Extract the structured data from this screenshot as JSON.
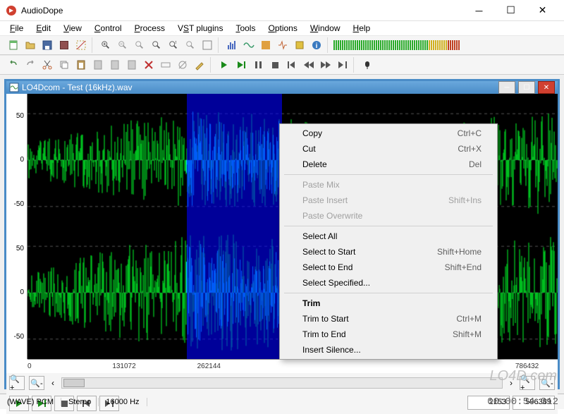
{
  "app": {
    "title": "AudioDope"
  },
  "menubar": [
    "File",
    "Edit",
    "View",
    "Control",
    "Process",
    "VST plugins",
    "Tools",
    "Options",
    "Window",
    "Help"
  ],
  "document": {
    "title": "LO4Dcom - Test (16kHz).wav",
    "y_ticks": [
      "50",
      "0",
      "-50",
      "50",
      "0",
      "-50"
    ],
    "x_ticks": [
      "0",
      "131072",
      "262144",
      "786432"
    ],
    "selection_boxes": [
      "2153",
      "596389"
    ]
  },
  "status": {
    "format": "(WAVE) PCM",
    "channels": "Stereo",
    "rate": "16000 Hz",
    "time": "00:00:54.312"
  },
  "context_menu": [
    {
      "type": "item",
      "label": "Copy",
      "shortcut": "Ctrl+C",
      "enabled": true
    },
    {
      "type": "item",
      "label": "Cut",
      "shortcut": "Ctrl+X",
      "enabled": true
    },
    {
      "type": "item",
      "label": "Delete",
      "shortcut": "Del",
      "enabled": true
    },
    {
      "type": "sep"
    },
    {
      "type": "item",
      "label": "Paste Mix",
      "shortcut": "",
      "enabled": false
    },
    {
      "type": "item",
      "label": "Paste Insert",
      "shortcut": "Shift+Ins",
      "enabled": false
    },
    {
      "type": "item",
      "label": "Paste Overwrite",
      "shortcut": "",
      "enabled": false
    },
    {
      "type": "sep"
    },
    {
      "type": "item",
      "label": "Select All",
      "shortcut": "",
      "enabled": true
    },
    {
      "type": "item",
      "label": "Select to Start",
      "shortcut": "Shift+Home",
      "enabled": true
    },
    {
      "type": "item",
      "label": "Select to End",
      "shortcut": "Shift+End",
      "enabled": true
    },
    {
      "type": "item",
      "label": "Select Specified...",
      "shortcut": "",
      "enabled": true
    },
    {
      "type": "sep"
    },
    {
      "type": "item",
      "label": "Trim",
      "shortcut": "",
      "enabled": true,
      "bold": true
    },
    {
      "type": "item",
      "label": "Trim to Start",
      "shortcut": "Ctrl+M",
      "enabled": true
    },
    {
      "type": "item",
      "label": "Trim to End",
      "shortcut": "Shift+M",
      "enabled": true
    },
    {
      "type": "item",
      "label": "Insert Silence...",
      "shortcut": "",
      "enabled": true
    }
  ],
  "watermark": "LO4D.com"
}
